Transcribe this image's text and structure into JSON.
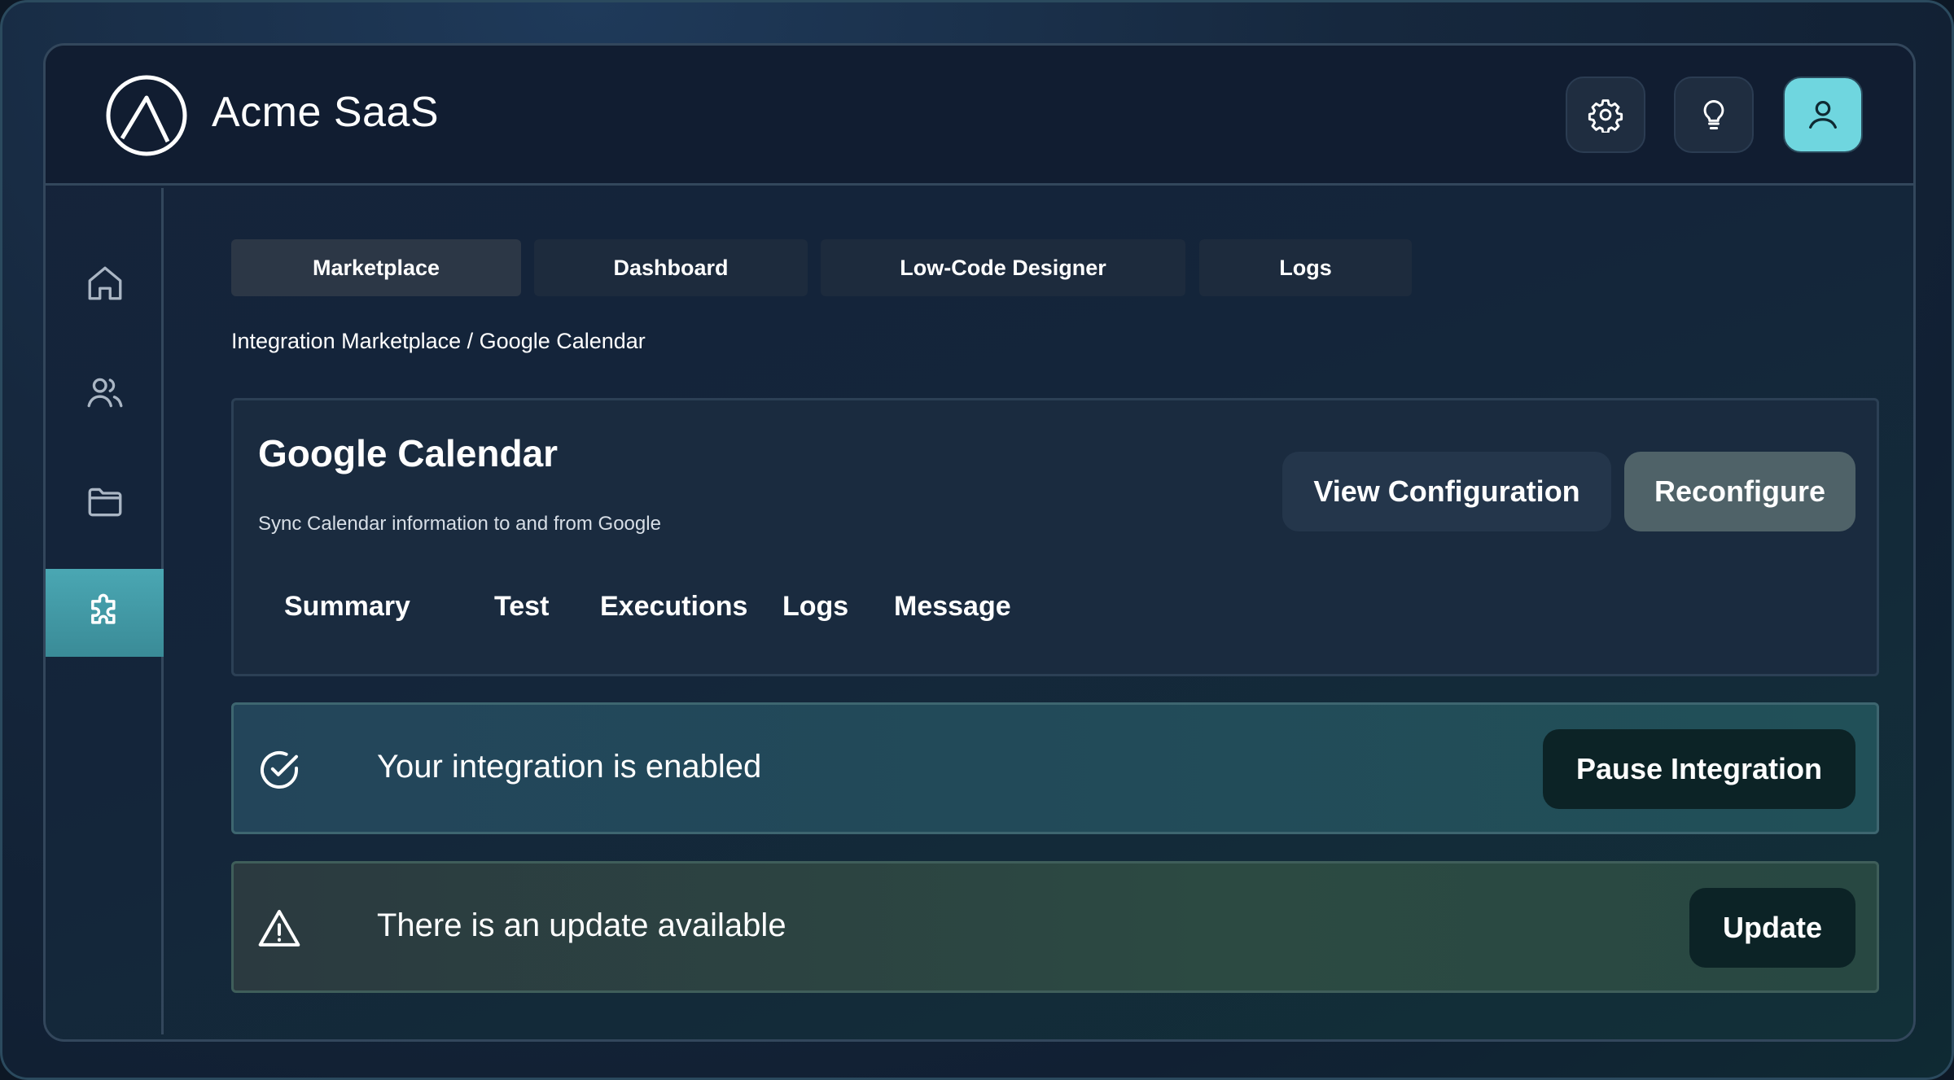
{
  "header": {
    "app_title": "Acme SaaS",
    "logo_icon": "acme-logo-icon",
    "buttons": [
      {
        "icon": "gear-icon"
      },
      {
        "icon": "lightbulb-icon"
      },
      {
        "icon": "user-icon"
      }
    ]
  },
  "sidebar": {
    "items": [
      {
        "icon": "home-icon"
      },
      {
        "icon": "users-icon"
      },
      {
        "icon": "folder-icon"
      },
      {
        "icon": "puzzle-icon",
        "active": true
      }
    ]
  },
  "tabs": [
    {
      "label": "Marketplace",
      "active": true
    },
    {
      "label": "Dashboard"
    },
    {
      "label": "Low-Code Designer"
    },
    {
      "label": "Logs"
    }
  ],
  "breadcrumb": "Integration Marketplace / Google Calendar",
  "integration": {
    "title": "Google Calendar",
    "subtitle": "Sync Calendar information to and from Google",
    "view_button": "View Configuration",
    "reconfigure_button": "Reconfigure",
    "sub_tabs": [
      "Summary",
      "Test",
      "Executions",
      "Logs",
      "Message"
    ]
  },
  "alerts": {
    "enabled": {
      "text": "Your integration is enabled",
      "button": "Pause Integration",
      "icon": "check-circle-icon"
    },
    "update": {
      "text": "There is an update available",
      "button": "Update",
      "icon": "warning-icon"
    }
  },
  "colors": {
    "accent": "#6fd6df",
    "sidebar_active": "#4aa7b3",
    "alert_button": "#0c2326"
  }
}
